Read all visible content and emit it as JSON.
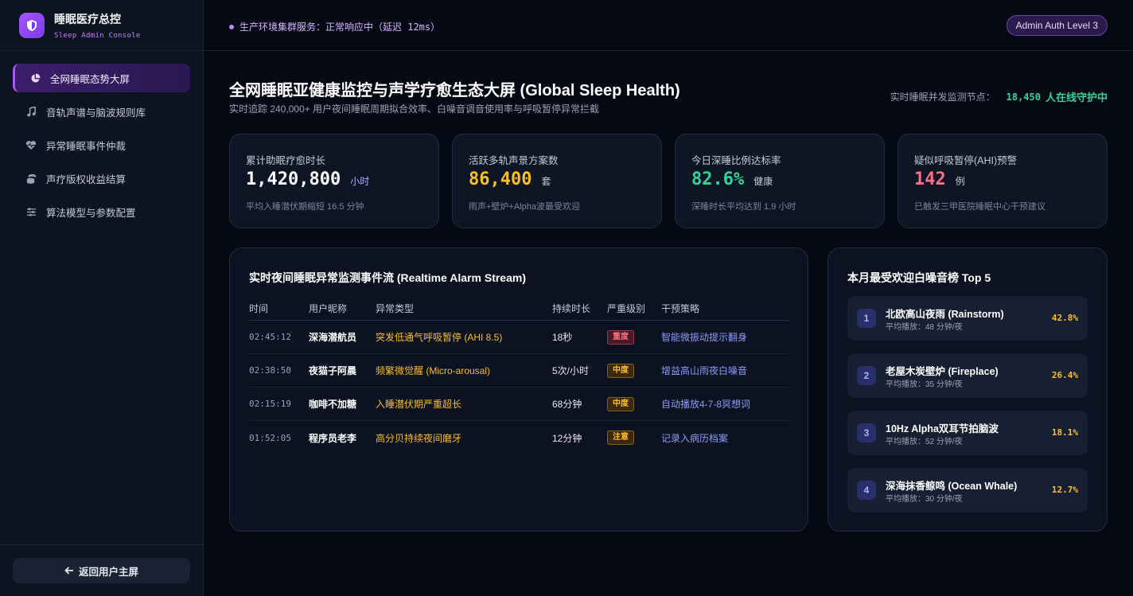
{
  "brand": {
    "title": "睡眠医疗总控",
    "subtitle": "Sleep Admin Console"
  },
  "nav": [
    {
      "label": "全网睡眠态势大屏",
      "icon": "pie-chart-icon",
      "active": true
    },
    {
      "label": "音轨声谱与脑波规则库",
      "icon": "music-note-icon",
      "active": false
    },
    {
      "label": "异常睡眠事件仲裁",
      "icon": "heart-pulse-icon",
      "active": false
    },
    {
      "label": "声疗版权收益结算",
      "icon": "coins-icon",
      "active": false
    },
    {
      "label": "算法模型与参数配置",
      "icon": "sliders-icon",
      "active": false
    }
  ],
  "back_button": "返回用户主屏",
  "topbar": {
    "status": "生产环境集群服务：正常响应中（延迟 12ms）",
    "admin_badge": "Admin Auth Level 3"
  },
  "header": {
    "title": "全网睡眠亚健康监控与声学疗愈生态大屏 (Global Sleep Health)",
    "subtitle": "实时追踪 240,000+ 用户夜间睡眠周期拟合效率、白噪音调音使用率与呼吸暂停异常拦截",
    "nodes_label": "实时睡眠并发监测节点：",
    "nodes_value": "18,450",
    "nodes_unit": "人在线守护中"
  },
  "stats": [
    {
      "label": "累计助眠疗愈时长",
      "value": "1,420,800",
      "unit": "小时",
      "note": "平均入睡潜伏期缩短 16.5 分钟",
      "color": "#ffffff",
      "unit_color": "#a5b4fc"
    },
    {
      "label": "活跃多轨声景方案数",
      "value": "86,400",
      "unit": "套",
      "note": "雨声+壁炉+Alpha波最受欢迎",
      "color": "#fbbf24",
      "unit_color": "#c4c9d6"
    },
    {
      "label": "今日深睡比例达标率",
      "value": "82.6%",
      "unit": "健康",
      "note": "深睡时长平均达到 1.9 小时",
      "color": "#34d399",
      "unit_color": "#c4c9d6"
    },
    {
      "label": "疑似呼吸暂停(AHI)预警",
      "value": "142",
      "unit": "例",
      "note": "已触发三甲医院睡眠中心干预建议",
      "color": "#fb7185",
      "unit_color": "#c4c9d6"
    }
  ],
  "alarm": {
    "title": "实时夜间睡眠异常监测事件流 (Realtime Alarm Stream)",
    "headers": [
      "时间",
      "用户昵称",
      "异常类型",
      "持续时长",
      "严重级别",
      "干预策略"
    ],
    "rows": [
      {
        "time": "02:45:12",
        "user": "深海潜航员",
        "type": "突发低通气呼吸暂停 (AHI 8.5)",
        "duration": "18秒",
        "severity": "重度",
        "level": "high",
        "action": "智能微振动提示翻身"
      },
      {
        "time": "02:38:50",
        "user": "夜猫子阿晨",
        "type": "频繁微觉醒 (Micro-arousal)",
        "duration": "5次/小时",
        "severity": "中度",
        "level": "mid",
        "action": "增益高山雨夜白噪音"
      },
      {
        "time": "02:15:19",
        "user": "咖啡不加糖",
        "type": "入睡潜伏期严重超长",
        "duration": "68分钟",
        "severity": "中度",
        "level": "mid",
        "action": "自动播放4-7-8冥想词"
      },
      {
        "time": "01:52:05",
        "user": "程序员老李",
        "type": "高分贝持续夜间磨牙",
        "duration": "12分钟",
        "severity": "注意",
        "level": "low",
        "action": "记录入病历档案"
      }
    ]
  },
  "ranking": {
    "title": "本月最受欢迎白噪音榜 Top 5",
    "items": [
      {
        "rank": "1",
        "name": "北欧高山夜雨 (Rainstorm)",
        "sub": "平均播放：48 分钟/夜",
        "pct": "42.8%"
      },
      {
        "rank": "2",
        "name": "老屋木炭壁炉 (Fireplace)",
        "sub": "平均播放：35 分钟/夜",
        "pct": "26.4%"
      },
      {
        "rank": "3",
        "name": "10Hz Alpha双耳节拍脑波",
        "sub": "平均播放：52 分钟/夜",
        "pct": "18.1%"
      },
      {
        "rank": "4",
        "name": "深海抹香鲸鸣 (Ocean Whale)",
        "sub": "平均播放：30 分钟/夜",
        "pct": "12.7%"
      }
    ]
  }
}
